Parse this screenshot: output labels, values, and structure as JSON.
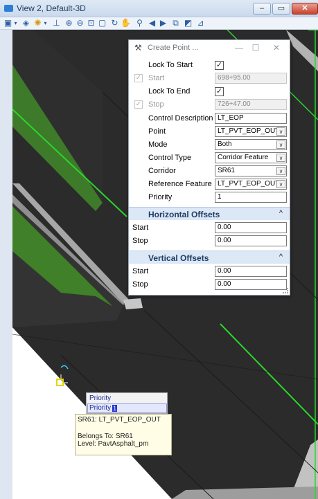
{
  "window": {
    "title": "View 2, Default-3D",
    "icon": "view-window-icon",
    "controls": {
      "minimize": "–",
      "maximize": "▭",
      "close": "✕"
    }
  },
  "toolbar": {
    "icons": [
      "view-attributes-icon",
      "dropdown-icon",
      "display-style-icon",
      "lighting-icon",
      "dropdown-icon",
      "clip-volume-icon",
      "zoom-in-icon",
      "zoom-out-icon",
      "window-area-icon",
      "fit-view-icon",
      "rotate-view-icon",
      "pan-view-icon",
      "walk-icon",
      "previous-view-icon",
      "next-view-icon",
      "copy-view-icon",
      "camera-icon",
      "more-icon"
    ]
  },
  "dialog": {
    "title": "Create Point ...",
    "icon": "tool-settings-icon",
    "controls": {
      "minimize": "—",
      "maximize": "☐",
      "close": "✕"
    },
    "fields": {
      "lock_to_start": {
        "label": "Lock To Start",
        "checked": "✓"
      },
      "start": {
        "label": "Start",
        "value": "698+95.00",
        "check": "✓"
      },
      "lock_to_end": {
        "label": "Lock To End",
        "checked": "✓"
      },
      "stop": {
        "label": "Stop",
        "value": "726+47.00",
        "check": "✓"
      },
      "control_description": {
        "label": "Control Description",
        "value": "LT_EOP"
      },
      "point": {
        "label": "Point",
        "value": "LT_PVT_EOP_OUT"
      },
      "mode": {
        "label": "Mode",
        "value": "Both"
      },
      "control_type": {
        "label": "Control Type",
        "value": "Corridor Feature"
      },
      "corridor": {
        "label": "Corridor",
        "value": "SR61"
      },
      "reference_feature": {
        "label": "Reference Feature",
        "value": "LT_PVT_EOP_OUT"
      },
      "priority": {
        "label": "Priority",
        "value": "1"
      }
    },
    "horizontal_offsets": {
      "title": "Horizontal Offsets",
      "start_label": "Start",
      "start_value": "0.00",
      "stop_label": "Stop",
      "stop_value": "0.00"
    },
    "vertical_offsets": {
      "title": "Vertical Offsets",
      "start_label": "Start",
      "start_value": "0.00",
      "stop_label": "Stop",
      "stop_value": "0.00"
    },
    "dropdown_arrow": "∨",
    "collapse_caret": "^"
  },
  "priority_prompt": {
    "item1": "Priority",
    "item2": "Priority",
    "cursor_value": "1"
  },
  "tooltip": {
    "line1": "SR61: LT_PVT_EOP_OUT",
    "line2": "Belongs To: SR61",
    "line3": "Level: PavtAsphalt_pm"
  },
  "colors": {
    "pavement": "#2a2a2a",
    "grass": "#3f7f2a",
    "concrete": "#a9a9a9",
    "feature_line": "#2bd62b",
    "accent": "#2d7fd6"
  }
}
